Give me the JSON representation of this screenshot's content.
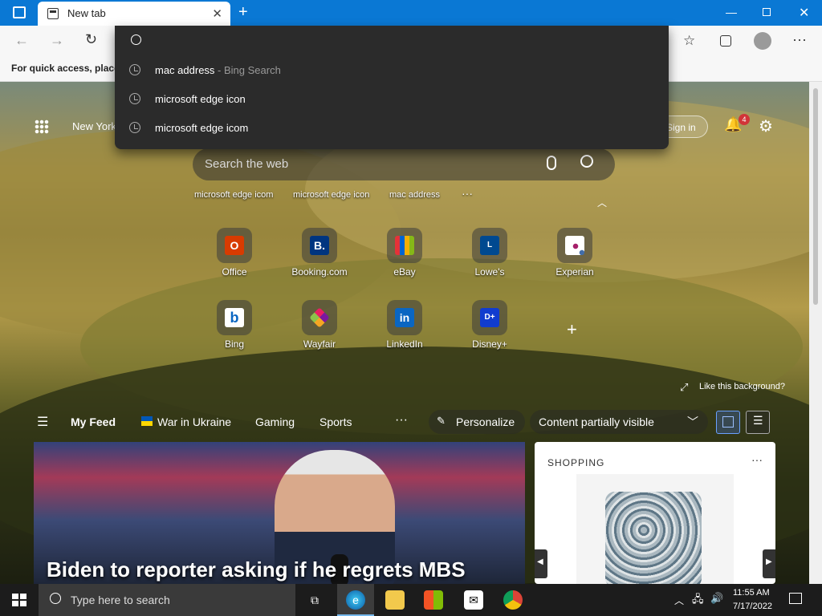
{
  "browser": {
    "tab_title": "New tab",
    "favorites_bar_text": "For quick access, place y"
  },
  "address_dropdown": {
    "items": [
      {
        "text": "mac address",
        "suffix": "- Bing Search"
      },
      {
        "text": "microsoft edge icon",
        "suffix": ""
      },
      {
        "text": "microsoft edge icom",
        "suffix": ""
      }
    ]
  },
  "newtab": {
    "location": "New York",
    "sign_in": "Sign in",
    "notification_count": "4",
    "search_placeholder": "Search the web",
    "recent_searches": [
      "microsoft edge icom",
      "microsoft edge icon",
      "mac address"
    ],
    "more": "···",
    "tiles": [
      {
        "name": "Office",
        "color": "#d83b01",
        "glyph": "O"
      },
      {
        "name": "Booking.com",
        "color": "#003580",
        "glyph": "B."
      },
      {
        "name": "eBay",
        "color": "#e53238",
        "glyph": ""
      },
      {
        "name": "Lowe's",
        "color": "#004990",
        "glyph": "L"
      },
      {
        "name": "Experian",
        "color": "#ffffff",
        "glyph": ""
      },
      {
        "name": "Bing",
        "color": "#ffffff",
        "glyph": "b"
      },
      {
        "name": "Wayfair",
        "color": "#7b189f",
        "glyph": ""
      },
      {
        "name": "LinkedIn",
        "color": "#0a66c2",
        "glyph": "in"
      },
      {
        "name": "Disney+",
        "color": "#113ccf",
        "glyph": "D+"
      }
    ],
    "add_tile": "+",
    "like_background": "Like this background?"
  },
  "feed": {
    "tabs": [
      "My Feed",
      "War in Ukraine",
      "Gaming",
      "Sports"
    ],
    "more": "···",
    "personalize": "Personalize",
    "content_visibility": "Content partially visible",
    "headline": "Biden to reporter asking if he regrets MBS",
    "shopping_label": "SHOPPING",
    "shopping_more": "···"
  },
  "taskbar": {
    "search_placeholder": "Type here to search",
    "time": "11:55 AM",
    "date": "7/17/2022"
  }
}
